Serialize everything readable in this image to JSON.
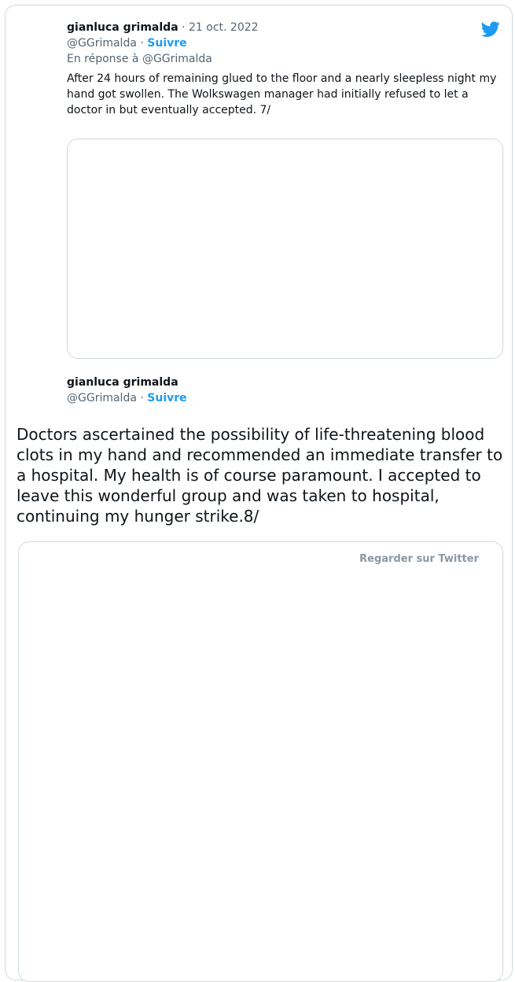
{
  "tweet1": {
    "author_name": "gianluca grimalda",
    "separator": "·",
    "date": "21 oct. 2022",
    "handle": "@GGrimalda",
    "follow_label": "Suivre",
    "reply_to": "En réponse à @GGrimalda",
    "text": "After 24 hours of remaining glued to the floor and a nearly sleepless night my hand got swollen. The Wolkswagen manager had initially refused to let a doctor in but eventually accepted. 7/"
  },
  "tweet2": {
    "author_name": "gianluca grimalda",
    "handle": "@GGrimalda",
    "separator": "·",
    "follow_label": "Suivre"
  },
  "main_text": "Doctors ascertained the possibility of life-threatening blood clots in my hand and recommended an immediate transfer to a hospital. My health is of course paramount. I accepted to leave this wonderful group and was taken to hospital, continuing my hunger strike.8/",
  "embed": {
    "watch_label": "Regarder sur Twitter"
  },
  "icons": {
    "brand": "twitter-bird-icon",
    "brand_color": "#1d9bf0"
  }
}
